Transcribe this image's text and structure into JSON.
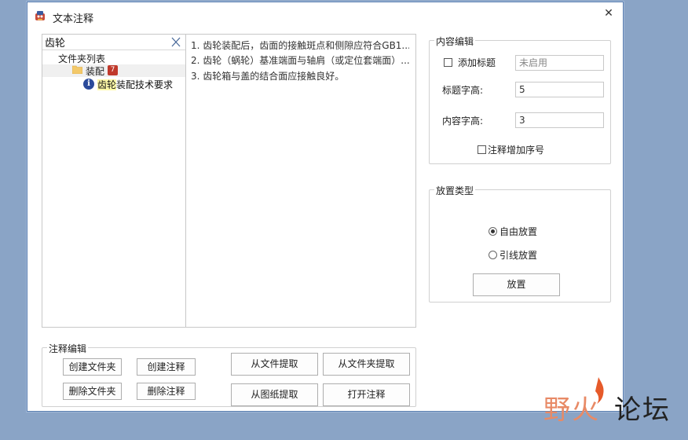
{
  "window": {
    "title": "文本注释",
    "close_glyph": "✕"
  },
  "tree": {
    "search_value": "齿轮",
    "root_label": "文件夹列表",
    "folder": {
      "label": "装配",
      "count": "7"
    },
    "note": {
      "highlight": "齿轮",
      "rest": "装配技术要求"
    }
  },
  "content": {
    "lines": [
      "1. 齿轮装配后，齿面的接触斑点和侧隙应符合GB1...",
      "2. 齿轮（蜗轮）基准端面与轴肩（或定位套端面）...",
      "3. 齿轮箱与盖的结合面应接触良好。"
    ]
  },
  "content_edit": {
    "group_title": "内容编辑",
    "add_title_label": "添加标题",
    "add_title_value": "未启用",
    "title_height_label": "标题字高:",
    "title_height_value": "5",
    "content_height_label": "内容字高:",
    "content_height_value": "3",
    "add_serial_label": "注释增加序号"
  },
  "placement": {
    "group_title": "放置类型",
    "free_label": "自由放置",
    "leader_label": "引线放置",
    "place_button": "放置",
    "selected": "自由放置"
  },
  "note_edit": {
    "group_title": "注释编辑",
    "create_folder": "创建文件夹",
    "create_note": "创建注释",
    "delete_folder": "删除文件夹",
    "delete_note": "删除注释",
    "extract_from_file": "从文件提取",
    "extract_from_folder": "从文件夹提取",
    "extract_from_drawing": "从图纸提取",
    "open_note": "打开注释"
  },
  "watermark": {
    "part1": "野火",
    "part2": "论坛"
  },
  "colors": {
    "desktop": "#8aa4c6",
    "badge": "#c0392b",
    "info_icon": "#2b4a9a",
    "highlight": "#fff9a8"
  }
}
